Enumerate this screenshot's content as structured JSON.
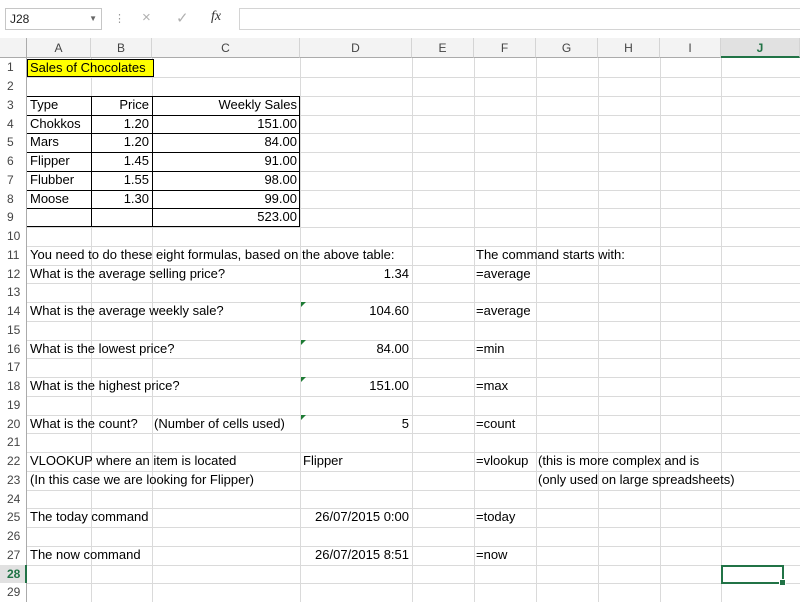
{
  "formula_bar": {
    "name_box": "J28",
    "cancel_icon": "×",
    "enter_icon": "✓",
    "fx_label": "fx",
    "formula": ""
  },
  "columns": [
    "A",
    "B",
    "C",
    "D",
    "E",
    "F",
    "G",
    "H",
    "I",
    "J"
  ],
  "selected_column": "J",
  "rows": [
    "1",
    "2",
    "3",
    "4",
    "5",
    "6",
    "7",
    "8",
    "9",
    "10",
    "11",
    "12",
    "13",
    "14",
    "15",
    "16",
    "17",
    "18",
    "19",
    "20",
    "21",
    "22",
    "23",
    "24",
    "25",
    "26",
    "27",
    "28",
    "29"
  ],
  "selected_row": "28",
  "title": "Sales of Chocolates",
  "table": {
    "headers": [
      "Type",
      "Price",
      "Weekly Sales"
    ],
    "rows": [
      [
        "Chokkos",
        "1.20",
        "151.00"
      ],
      [
        "Mars",
        "1.20",
        "84.00"
      ],
      [
        "Flipper",
        "1.45",
        "91.00"
      ],
      [
        "Flubber",
        "1.55",
        "98.00"
      ],
      [
        "Moose",
        "1.30",
        "99.00"
      ],
      [
        "",
        "",
        "523.00"
      ]
    ]
  },
  "instructions": {
    "intro": "You need to do these eight formulas, based on the above table:",
    "command_header": "The command starts with:",
    "q1": "What is the average selling price?",
    "a1": "1.34",
    "c1": "=average",
    "q2": "What is the average weekly sale?",
    "a2": "104.60",
    "c2": "=average",
    "q3": "What is the lowest price?",
    "a3": "84.00",
    "c3": "=min",
    "q4": "What is the highest price?",
    "a4": "151.00",
    "c4": "=max",
    "q5": "What is the count?",
    "q5b": "(Number of cells used)",
    "a5": "5",
    "c5": "=count",
    "q6": "VLOOKUP where an item is located",
    "a6": "Flipper",
    "c6": "=vlookup",
    "n6": "(this is more complex and is",
    "q6b": "(In this case we are looking for Flipper)",
    "n6b": "(only used on large spreadsheets)",
    "q7": "The today command",
    "a7": "26/07/2015 0:00",
    "c7": "=today",
    "q8": "The now command",
    "a8": "26/07/2015 8:51",
    "c8": "=now"
  },
  "colors": {
    "accent": "#217346",
    "title_fill": "#ffff00",
    "error_triangle": "#1e7b34"
  }
}
